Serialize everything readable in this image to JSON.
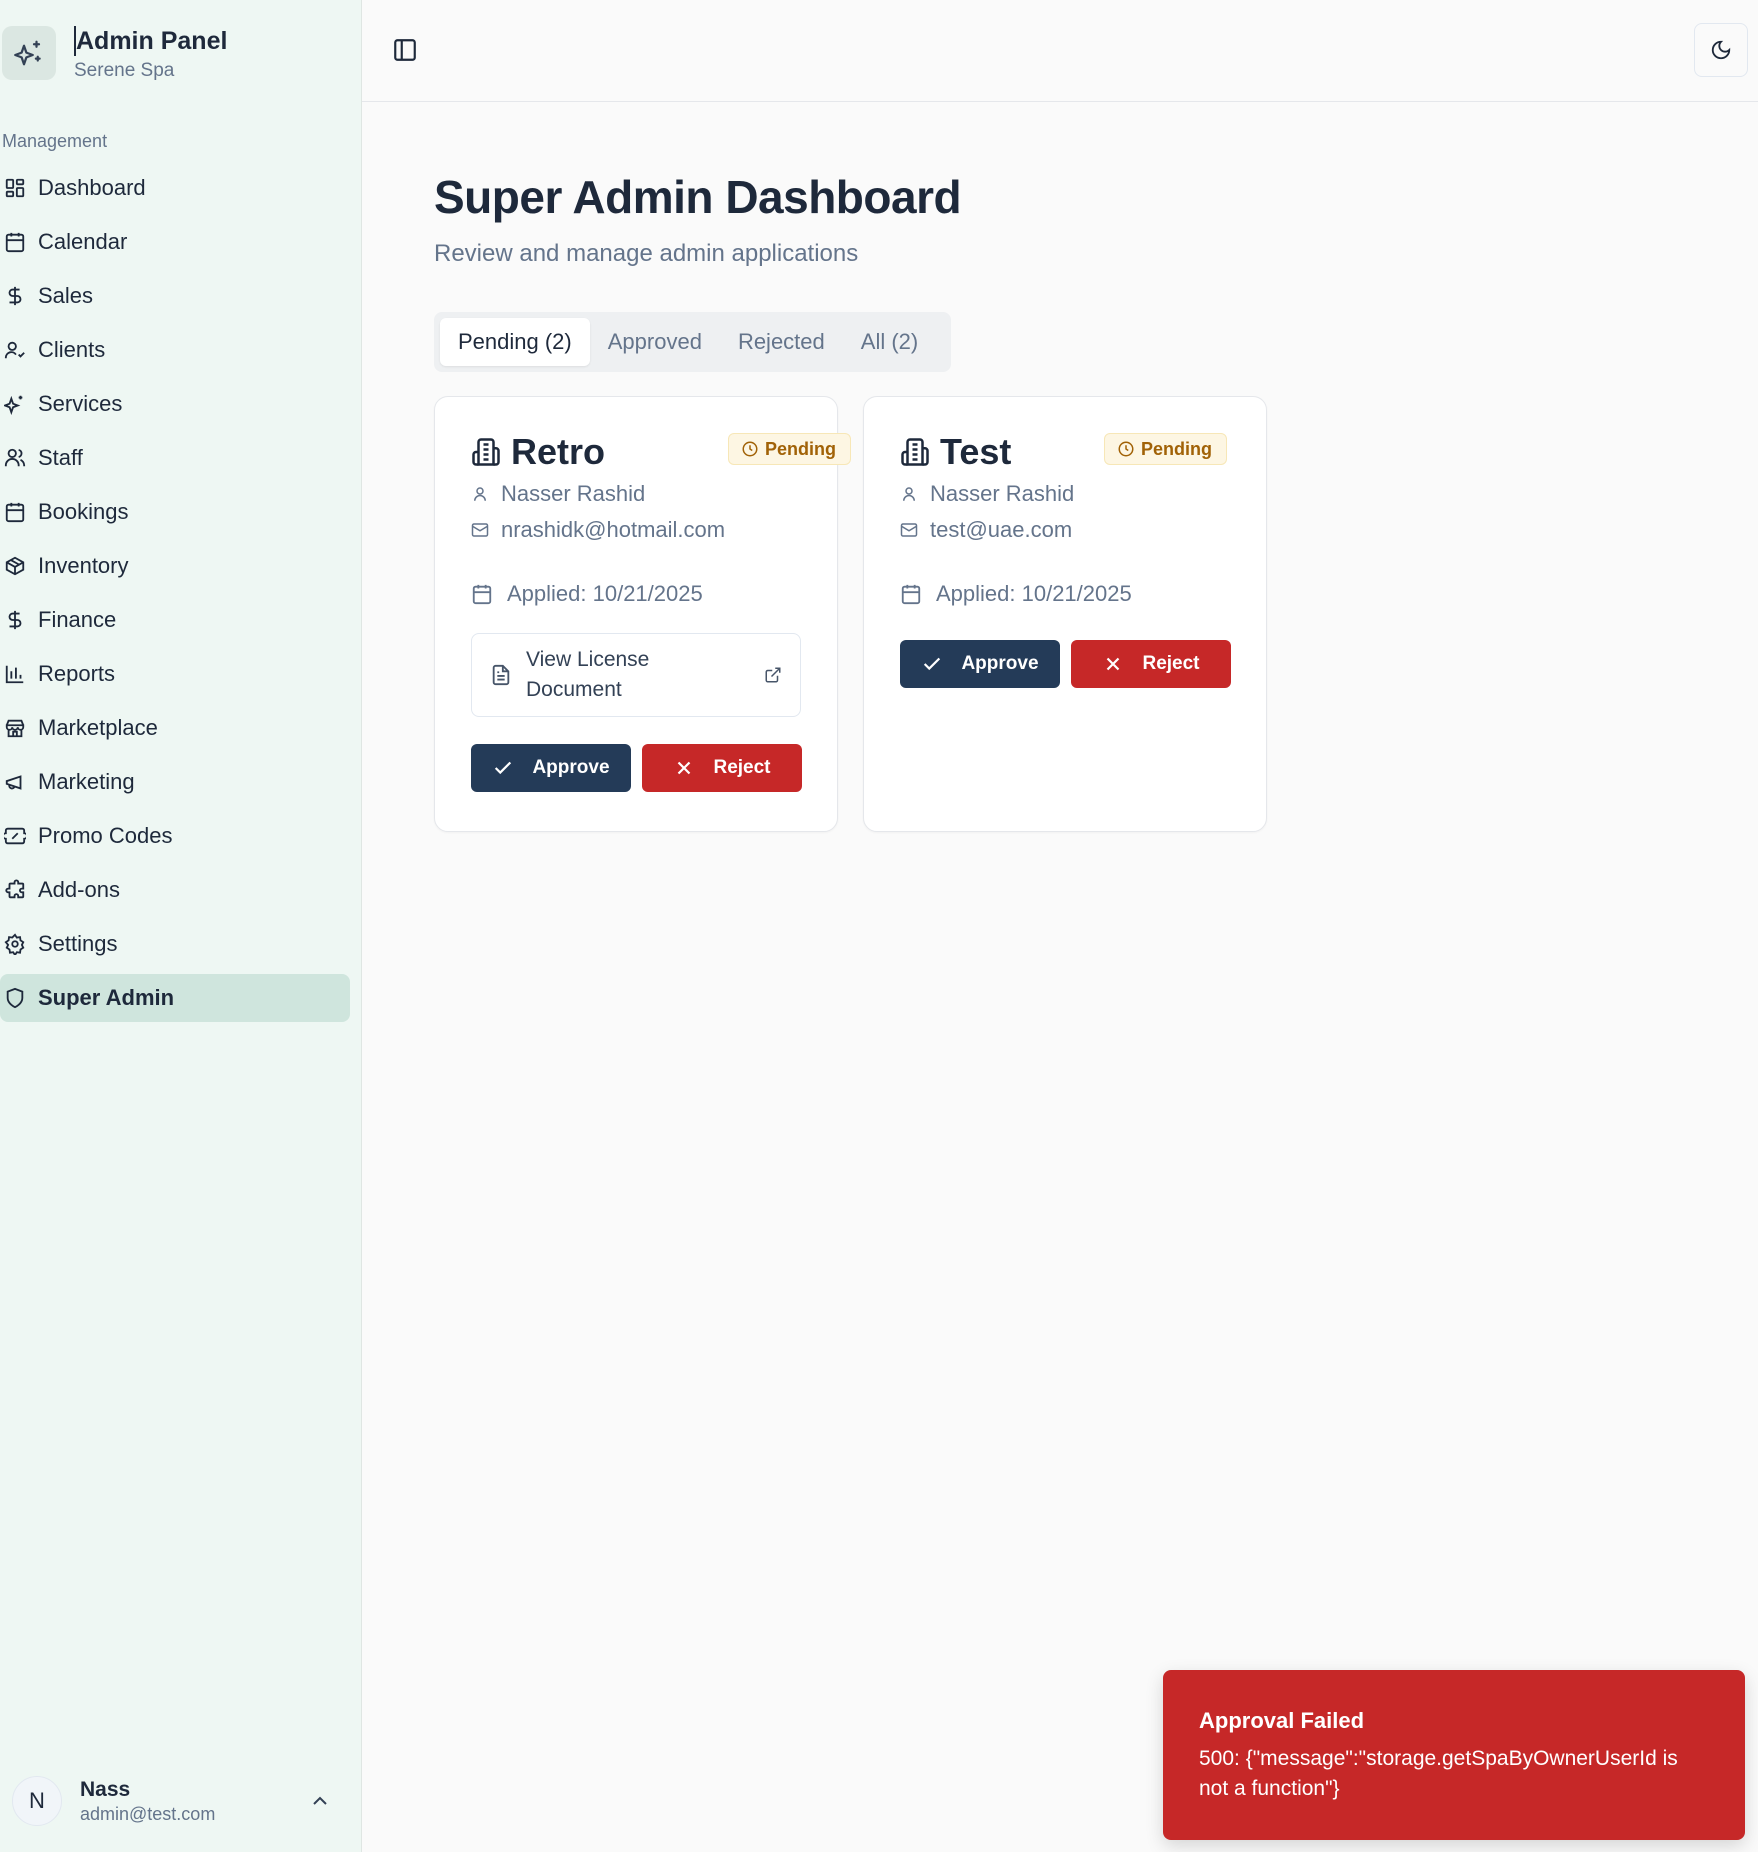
{
  "brand": {
    "title": "Admin Panel",
    "subtitle": "Serene Spa",
    "icon": "sparkles-icon"
  },
  "sidebar": {
    "group_label": "Management",
    "items": [
      {
        "label": "Dashboard",
        "icon": "layout-grid-icon"
      },
      {
        "label": "Calendar",
        "icon": "calendar-icon"
      },
      {
        "label": "Sales",
        "icon": "dollar-icon"
      },
      {
        "label": "Clients",
        "icon": "user-check-icon"
      },
      {
        "label": "Services",
        "icon": "sparkles-icon"
      },
      {
        "label": "Staff",
        "icon": "users-icon"
      },
      {
        "label": "Bookings",
        "icon": "calendar-icon"
      },
      {
        "label": "Inventory",
        "icon": "package-icon"
      },
      {
        "label": "Finance",
        "icon": "dollar-icon"
      },
      {
        "label": "Reports",
        "icon": "bar-chart-icon"
      },
      {
        "label": "Marketplace",
        "icon": "store-icon"
      },
      {
        "label": "Marketing",
        "icon": "megaphone-icon"
      },
      {
        "label": "Promo Codes",
        "icon": "ticket-icon"
      },
      {
        "label": "Add-ons",
        "icon": "puzzle-icon"
      },
      {
        "label": "Settings",
        "icon": "gear-icon"
      },
      {
        "label": "Super Admin",
        "icon": "shield-icon",
        "active": true
      }
    ]
  },
  "user": {
    "initial": "N",
    "name": "Nass",
    "email": "admin@test.com"
  },
  "main": {
    "title": "Super Admin Dashboard",
    "subtitle": "Review and manage admin applications",
    "tabs": [
      {
        "label": "Pending (2)",
        "active": true
      },
      {
        "label": "Approved"
      },
      {
        "label": "Rejected"
      },
      {
        "label": "All (2)"
      }
    ]
  },
  "applications": [
    {
      "name": "Retro",
      "status": "Pending",
      "owner": "Nasser Rashid",
      "email": "nrashidk@hotmail.com",
      "applied": "Applied: 10/21/2025",
      "license_label": "View License Document",
      "approve_label": "Approve",
      "reject_label": "Reject"
    },
    {
      "name": "Test",
      "status": "Pending",
      "owner": "Nasser Rashid",
      "email": "test@uae.com",
      "applied": "Applied: 10/21/2025",
      "approve_label": "Approve",
      "reject_label": "Reject"
    }
  ],
  "toast": {
    "title": "Approval Failed",
    "message": "500: {\"message\":\"storage.getSpaByOwnerUserId is not a function\"}"
  },
  "colors": {
    "primary": "#243b58",
    "danger": "#c62828",
    "pending": "#a16207",
    "sidebar_bg": "#eef7f3",
    "sidebar_active": "#cfe5dd"
  }
}
